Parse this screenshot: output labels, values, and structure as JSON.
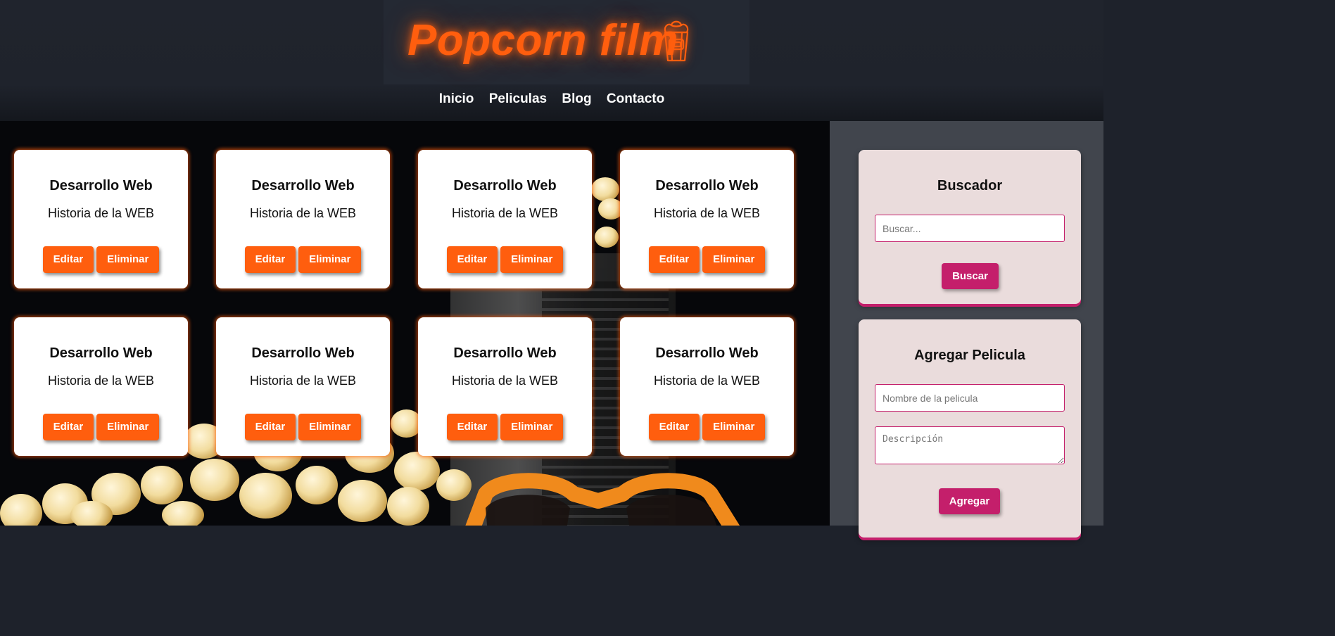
{
  "brand": {
    "title": "Popcorn film",
    "accent_color": "#ff5e0e",
    "icon": "popcorn-icon"
  },
  "nav": {
    "items": [
      {
        "label": "Inicio"
      },
      {
        "label": "Peliculas"
      },
      {
        "label": "Blog"
      },
      {
        "label": "Contacto"
      }
    ]
  },
  "cards": [
    {
      "title": "Desarrollo Web",
      "description": "Historia de la WEB",
      "edit_label": "Editar",
      "delete_label": "Eliminar"
    },
    {
      "title": "Desarrollo Web",
      "description": "Historia de la WEB",
      "edit_label": "Editar",
      "delete_label": "Eliminar"
    },
    {
      "title": "Desarrollo Web",
      "description": "Historia de la WEB",
      "edit_label": "Editar",
      "delete_label": "Eliminar"
    },
    {
      "title": "Desarrollo Web",
      "description": "Historia de la WEB",
      "edit_label": "Editar",
      "delete_label": "Eliminar"
    },
    {
      "title": "Desarrollo Web",
      "description": "Historia de la WEB",
      "edit_label": "Editar",
      "delete_label": "Eliminar"
    },
    {
      "title": "Desarrollo Web",
      "description": "Historia de la WEB",
      "edit_label": "Editar",
      "delete_label": "Eliminar"
    },
    {
      "title": "Desarrollo Web",
      "description": "Historia de la WEB",
      "edit_label": "Editar",
      "delete_label": "Eliminar"
    },
    {
      "title": "Desarrollo Web",
      "description": "Historia de la WEB",
      "edit_label": "Editar",
      "delete_label": "Eliminar"
    }
  ],
  "sidebar": {
    "search": {
      "title": "Buscador",
      "placeholder": "Buscar...",
      "value": "",
      "button_label": "Buscar"
    },
    "add_movie": {
      "title": "Agregar Pelicula",
      "name_placeholder": "Nombre de la pelicula",
      "description_placeholder": "Descripción",
      "button_label": "Agregar"
    },
    "accent_color": "#c41f6b"
  }
}
